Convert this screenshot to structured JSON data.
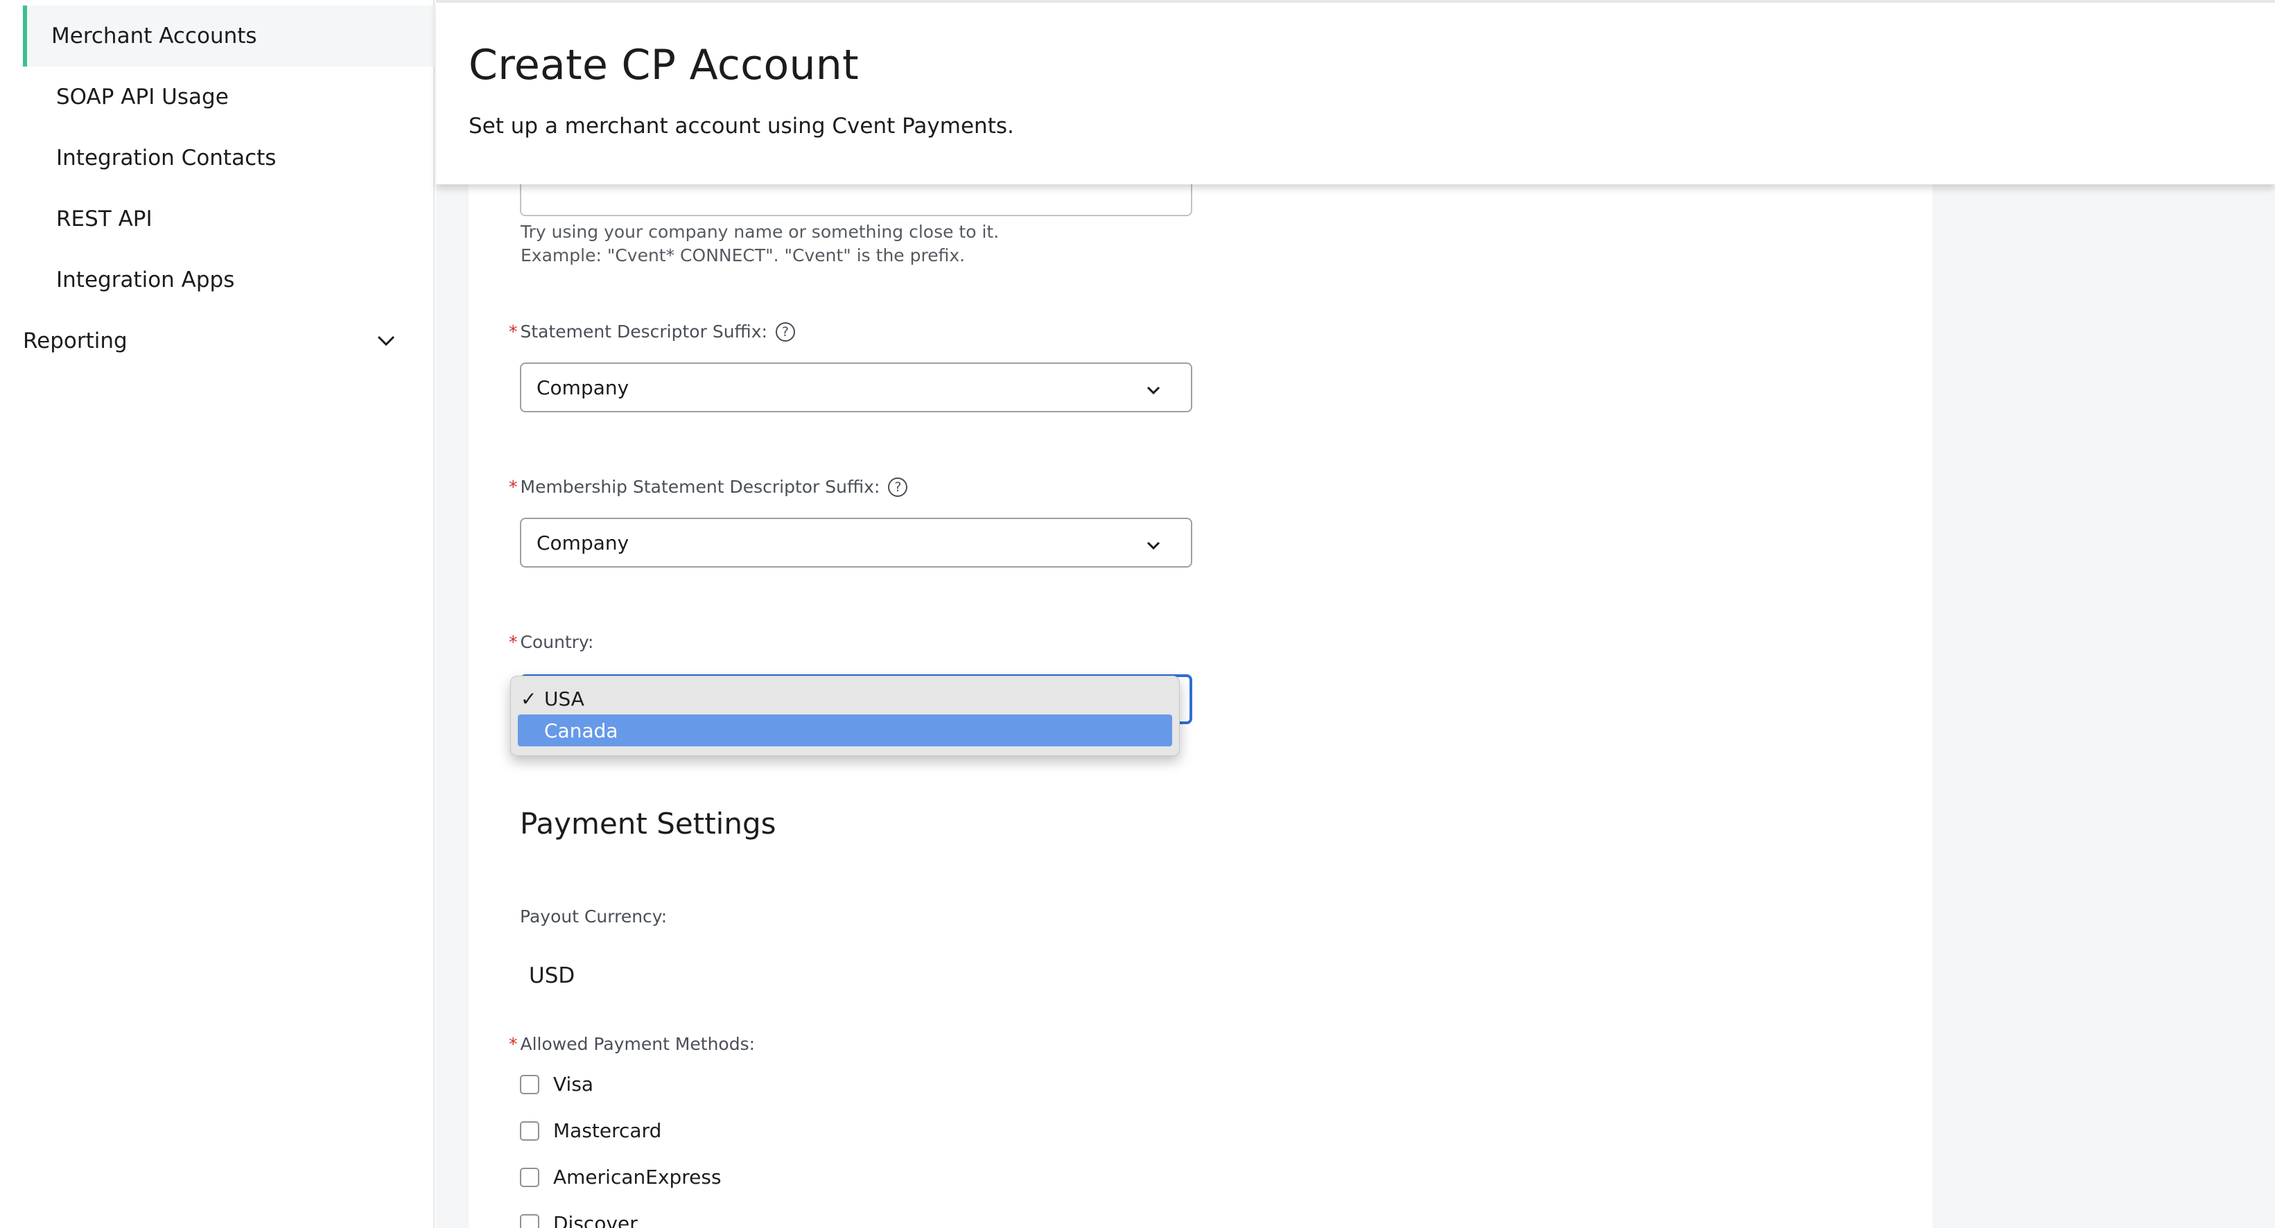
{
  "sidebar": {
    "items": [
      {
        "label": "Merchant Accounts",
        "active": true
      },
      {
        "label": "SOAP API Usage"
      },
      {
        "label": "Integration Contacts"
      },
      {
        "label": "REST API"
      },
      {
        "label": "Integration Apps"
      }
    ],
    "section": {
      "label": "Reporting",
      "icon": "chevron-down-icon"
    }
  },
  "header": {
    "title": "Create CP Account",
    "subtitle": "Set up a merchant account using Cvent Payments."
  },
  "form": {
    "prefix_help": [
      "Try using your company name or something close to it.",
      "Example: \"Cvent* CONNECT\". \"Cvent\" is the prefix."
    ],
    "suffix": {
      "label": "Statement Descriptor Suffix:",
      "value": "Company",
      "required_mark": "*",
      "help_icon": "?"
    },
    "membership_suffix": {
      "label": "Membership Statement Descriptor Suffix:",
      "value": "Company",
      "required_mark": "*",
      "help_icon": "?"
    },
    "country": {
      "label": "Country:",
      "required_mark": "*",
      "options": [
        {
          "label": "USA",
          "checked": true,
          "check_mark": "✓"
        },
        {
          "label": "Canada",
          "highlighted": true
        }
      ]
    },
    "payment_settings": {
      "title": "Payment Settings",
      "payout_currency_label": "Payout Currency:",
      "payout_currency_value": "USD",
      "methods_label": "Allowed Payment Methods:",
      "methods_required_mark": "*",
      "methods": [
        "Visa",
        "Mastercard",
        "AmericanExpress",
        "Discover"
      ]
    }
  },
  "colors": {
    "active_indicator": "#3dbf8f",
    "focus_border": "#2f6fd6",
    "highlight_option": "#6699e8",
    "required": "#d0312d"
  }
}
